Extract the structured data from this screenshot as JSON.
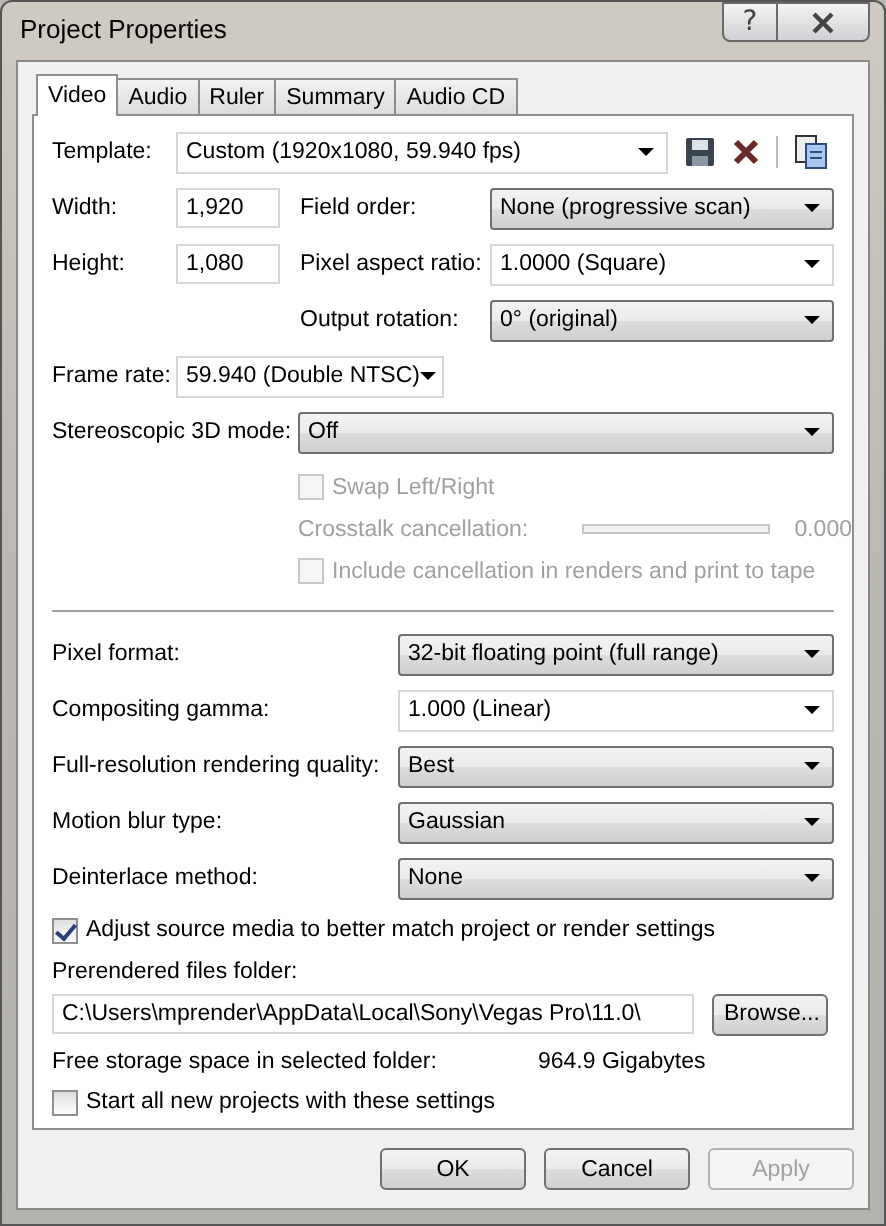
{
  "window": {
    "title": "Project Properties",
    "help": "?"
  },
  "tabs": [
    {
      "label": "Video",
      "selected": true
    },
    {
      "label": "Audio",
      "selected": false
    },
    {
      "label": "Ruler",
      "selected": false
    },
    {
      "label": "Summary",
      "selected": false
    },
    {
      "label": "Audio CD",
      "selected": false
    }
  ],
  "template": {
    "label": "Template:",
    "value": "Custom (1920x1080, 59.940 fps)",
    "kind": "combo"
  },
  "width": {
    "label": "Width:",
    "value": "1,920"
  },
  "height": {
    "label": "Height:",
    "value": "1,080"
  },
  "field_order": {
    "label": "Field order:",
    "value": "None (progressive scan)",
    "kind": "list"
  },
  "pixel_aspect_ratio": {
    "label": "Pixel aspect ratio:",
    "value": "1.0000 (Square)",
    "kind": "combo"
  },
  "output_rotation": {
    "label": "Output rotation:",
    "value": "0° (original)",
    "kind": "list"
  },
  "frame_rate": {
    "label": "Frame rate:",
    "value": "59.940 (Double NTSC)",
    "kind": "combo"
  },
  "stereoscopic": {
    "label": "Stereoscopic 3D mode:",
    "value": "Off",
    "kind": "list"
  },
  "swap": {
    "label": "Swap Left/Right",
    "checked": false,
    "disabled": true
  },
  "crosstalk": {
    "label": "Crosstalk cancellation:",
    "reading": "0.000",
    "disabled": true
  },
  "include_cancellation": {
    "label": "Include cancellation in renders and print to tape",
    "checked": false,
    "disabled": true
  },
  "render_settings": [
    {
      "label": "Pixel format:",
      "value": "32-bit floating point (full range)",
      "kind": "list"
    },
    {
      "label": "Compositing gamma:",
      "value": "1.000 (Linear)",
      "kind": "combo"
    },
    {
      "label": "Full-resolution rendering quality:",
      "value": "Best",
      "kind": "list"
    },
    {
      "label": "Motion blur type:",
      "value": "Gaussian",
      "kind": "list"
    },
    {
      "label": "Deinterlace method:",
      "value": "None",
      "kind": "list"
    }
  ],
  "adjust_source": {
    "label": "Adjust source media to better match project or render settings",
    "checked": true,
    "disabled": false
  },
  "prerendered": {
    "label": "Prerendered files folder:",
    "value": "C:\\Users\\mprender\\AppData\\Local\\Sony\\Vegas Pro\\11.0\\",
    "browse": "Browse..."
  },
  "free_storage": {
    "label": "Free storage space in selected folder:",
    "value": "964.9 Gigabytes"
  },
  "start_new": {
    "label": "Start all new projects with these settings",
    "checked": false,
    "disabled": false
  },
  "buttons": [
    {
      "label": "OK",
      "disabled": false
    },
    {
      "label": "Cancel",
      "disabled": false
    },
    {
      "label": "Apply",
      "disabled": true
    }
  ]
}
